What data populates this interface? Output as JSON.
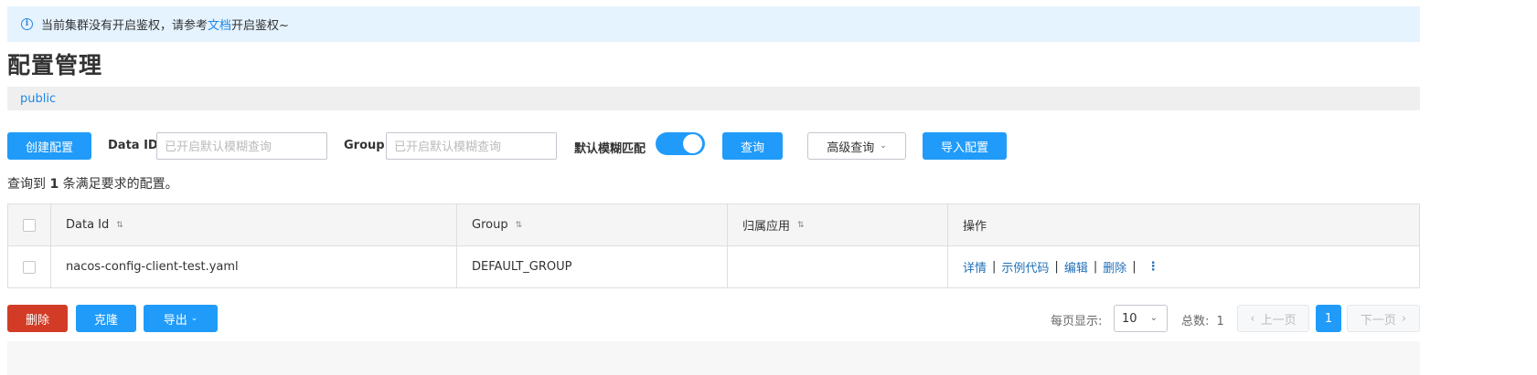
{
  "notice": {
    "prefix": "当前集群没有开启鉴权，请参考",
    "link": "文档",
    "suffix": "开启鉴权~",
    "icon": "info-icon"
  },
  "page_title": "配置管理",
  "namespace": "public",
  "toolbar": {
    "create_label": "创建配置",
    "data_id_label": "Data ID",
    "data_id_placeholder": "已开启默认模糊查询",
    "group_label": "Group",
    "group_placeholder": "已开启默认模糊查询",
    "fuzzy_label": "默认模糊匹配",
    "fuzzy_enabled": true,
    "query_label": "查询",
    "advanced_label": "高级查询",
    "import_label": "导入配置"
  },
  "result": {
    "prefix": "查询到",
    "count": "1",
    "suffix": "条满足要求的配置。"
  },
  "table": {
    "columns": [
      "Data Id",
      "Group",
      "归属应用",
      "操作"
    ],
    "rows": [
      {
        "data_id": "nacos-config-client-test.yaml",
        "group": "DEFAULT_GROUP",
        "app": "",
        "ops": [
          "详情",
          "示例代码",
          "编辑",
          "删除"
        ]
      }
    ]
  },
  "bottom_actions": {
    "delete_label": "删除",
    "clone_label": "克隆",
    "export_label": "导出"
  },
  "pagination": {
    "page_size_label": "每页显示:",
    "page_size": "10",
    "total_label": "总数:",
    "total": "1",
    "prev_label": "上一页",
    "current_page": "1",
    "next_label": "下一页"
  },
  "colors": {
    "primary": "#209bfa",
    "danger": "#d23c26",
    "link": "#1f87e4"
  }
}
